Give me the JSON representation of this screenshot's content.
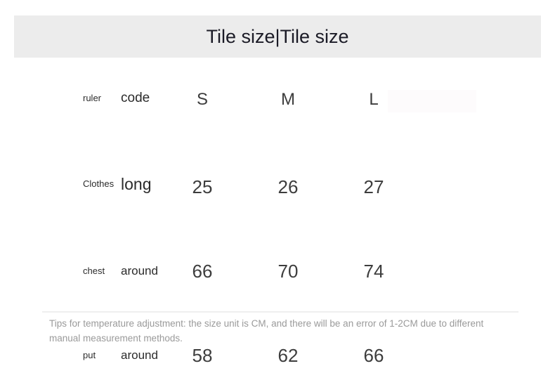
{
  "header": {
    "title": "Tile size|Tile size"
  },
  "table": {
    "rows": [
      {
        "label": "ruler",
        "sublabel": "code",
        "s": "S",
        "m": "M",
        "l": "L"
      },
      {
        "label": "Clothes",
        "sublabel": "long",
        "s": "25",
        "m": "26",
        "l": "27"
      },
      {
        "label": "chest",
        "sublabel": "around",
        "s": "66",
        "m": "70",
        "l": "74"
      },
      {
        "label": "put",
        "sublabel": "around",
        "s": "58",
        "m": "62",
        "l": "66"
      }
    ]
  },
  "footer": {
    "tips": "Tips for temperature adjustment: the size unit is CM, and there will be an error of 1-2CM due to different manual measurement methods."
  },
  "colors": {
    "title_band": "#ececec",
    "title_text": "#1b1b26",
    "table_text": "#3d3d3d",
    "tips_text": "#9a9a9a",
    "divider": "#efefef",
    "tint": "#fdfbfc",
    "page_background": "#ffffff"
  }
}
